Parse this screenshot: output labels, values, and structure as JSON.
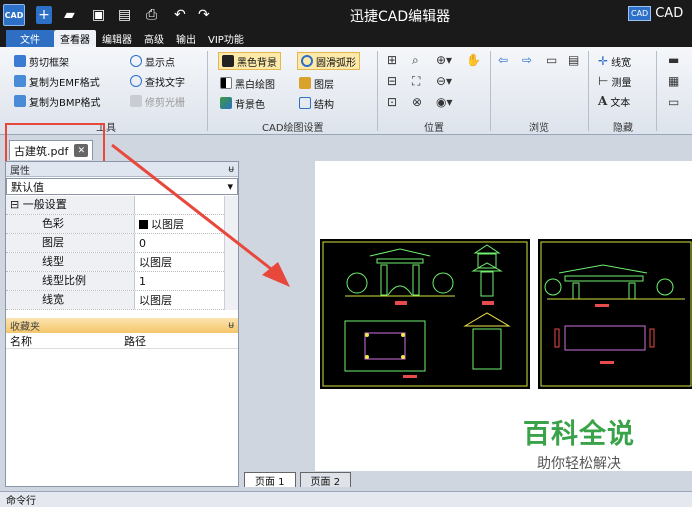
{
  "titlebar": {
    "logo": "CAD",
    "title": "迅捷CAD编辑器",
    "right_logo": "CAD",
    "right_text": "CAD"
  },
  "menu": {
    "tabs": [
      "文件",
      "查看器",
      "编辑器",
      "高级",
      "输出",
      "VIP功能"
    ],
    "active": "查看器"
  },
  "ribbon": {
    "group1": {
      "label": "工具",
      "buttons": [
        "剪切框架",
        "复制为EMF格式",
        "复制为BMP格式",
        "显示点",
        "查找文字",
        "修剪光栅"
      ]
    },
    "group2": {
      "label": "CAD绘图设置",
      "buttons": [
        "黑色背景",
        "黑白绘图",
        "背景色",
        "圆滑弧形",
        "图层",
        "结构"
      ]
    },
    "group3": {
      "label": "位置"
    },
    "group4": {
      "label": "浏览"
    },
    "group5": {
      "label": "隐藏",
      "buttons": [
        "线宽",
        "测量",
        "文本"
      ]
    }
  },
  "doc_tab": {
    "name": "古建筑.pdf",
    "close": "✕"
  },
  "properties": {
    "header": "属性",
    "pin": "ᵾ",
    "dropdown": "默认值",
    "category": "一般设置",
    "rows": [
      {
        "key": "色彩",
        "value": "以图层",
        "swatch": "#000000"
      },
      {
        "key": "图层",
        "value": "0"
      },
      {
        "key": "线型",
        "value": "以图层"
      },
      {
        "key": "线型比例",
        "value": "1"
      },
      {
        "key": "线宽",
        "value": "以图层"
      }
    ]
  },
  "favorites": {
    "header": "收藏夹",
    "pin": "ᵾ",
    "col_name": "名称",
    "col_path": "路径"
  },
  "pages": [
    "页面 1",
    "页面 2"
  ],
  "command_bar": "命令行",
  "watermark": {
    "big": "百科全说",
    "small": "助你轻松解决"
  },
  "colors": {
    "accent": "#2e6fc4",
    "highlight": "#e8473c",
    "watermark": "#3aa34a"
  }
}
